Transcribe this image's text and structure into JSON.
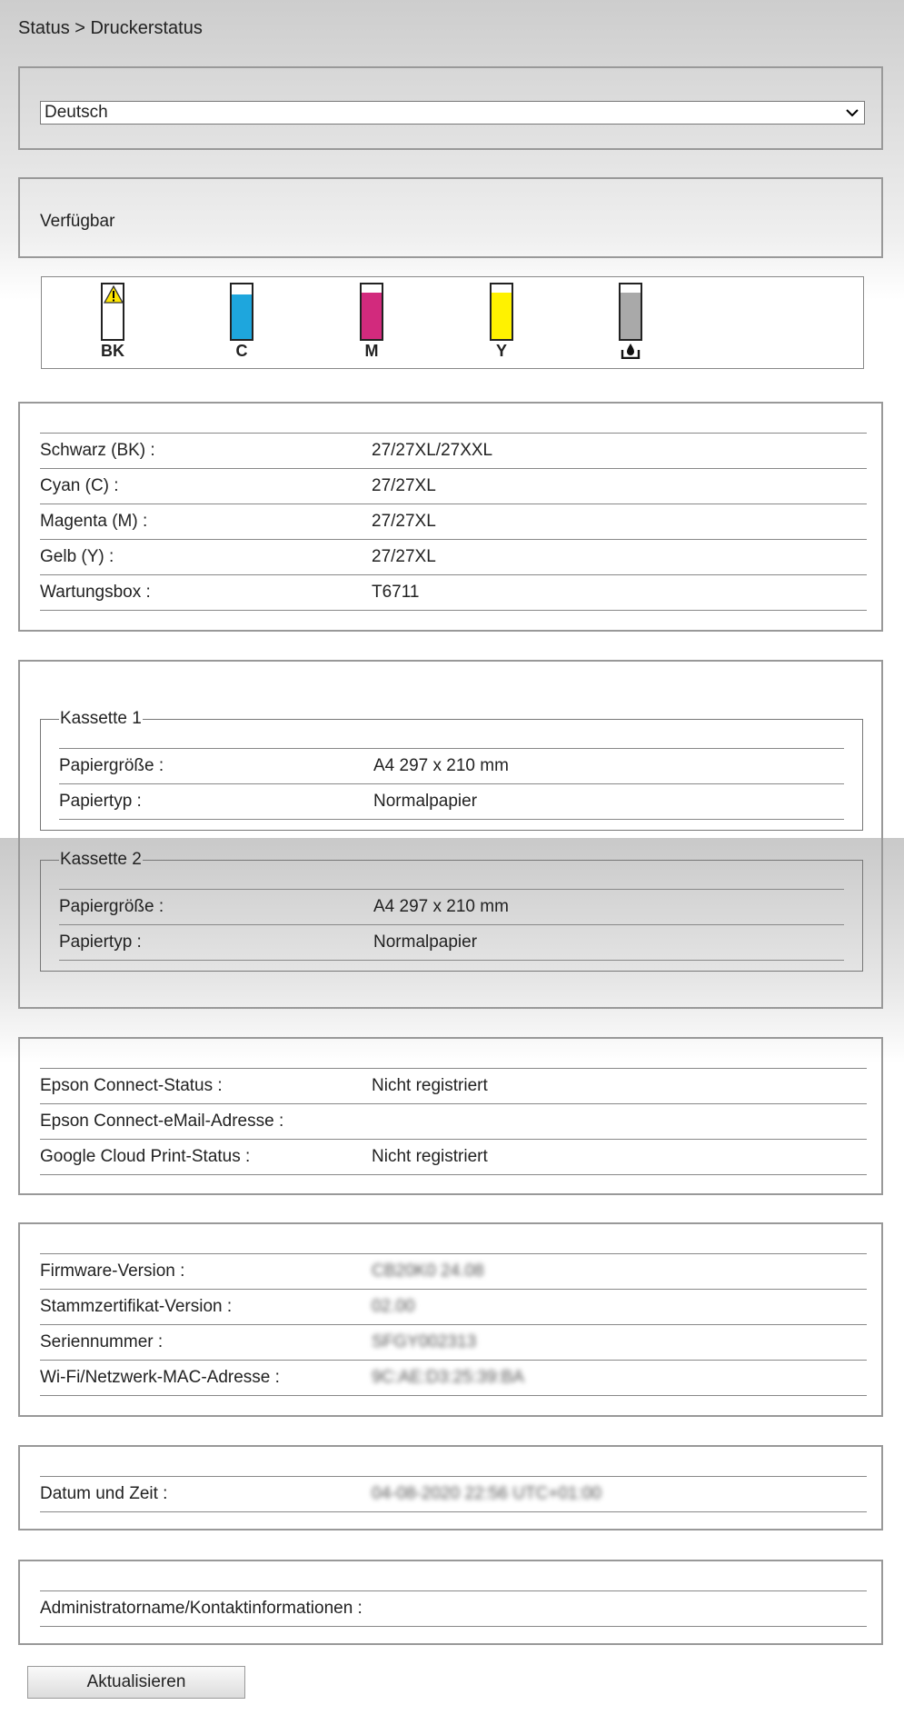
{
  "breadcrumb": "Status > Druckerstatus",
  "language": {
    "selected": "Deutsch"
  },
  "availability": "Verfügbar",
  "ink_levels": [
    {
      "label": "BK",
      "color": "#ffffff",
      "level": 0.0,
      "warning": true
    },
    {
      "label": "C",
      "color": "#1ea6dd",
      "level": 0.82,
      "warning": false
    },
    {
      "label": "M",
      "color": "#d22a7d",
      "level": 0.85,
      "warning": false
    },
    {
      "label": "Y",
      "color": "#fff200",
      "level": 0.85,
      "warning": false
    },
    {
      "label": "",
      "color": "#a9a9a9",
      "level": 0.85,
      "warning": false,
      "icon": "maintenance-box-icon"
    }
  ],
  "cartridges": [
    {
      "key": "Schwarz (BK) :",
      "value": "27/27XL/27XXL"
    },
    {
      "key": "Cyan (C) :",
      "value": "27/27XL"
    },
    {
      "key": "Magenta (M) :",
      "value": "27/27XL"
    },
    {
      "key": "Gelb (Y) :",
      "value": "27/27XL"
    },
    {
      "key": "Wartungsbox :",
      "value": "T6711"
    }
  ],
  "cassettes": [
    {
      "name": "Kassette 1",
      "rows": [
        {
          "key": "Papiergröße :",
          "value": "A4 297 x 210 mm"
        },
        {
          "key": "Papiertyp :",
          "value": "Normalpapier"
        }
      ]
    },
    {
      "name": "Kassette 2",
      "rows": [
        {
          "key": "Papiergröße :",
          "value": "A4 297 x 210 mm"
        },
        {
          "key": "Papiertyp :",
          "value": "Normalpapier"
        }
      ]
    }
  ],
  "connect": [
    {
      "key": "Epson Connect-Status :",
      "value": "Nicht registriert"
    },
    {
      "key": "Epson Connect-eMail-Adresse :",
      "value": ""
    },
    {
      "key": "Google Cloud Print-Status :",
      "value": "Nicht registriert"
    }
  ],
  "device": [
    {
      "key": "Firmware-Version :",
      "value": "CB20K0 24.08"
    },
    {
      "key": "Stammzertifikat-Version :",
      "value": "02.00"
    },
    {
      "key": "Seriennummer :",
      "value": "SFGY002313"
    },
    {
      "key": "Wi-Fi/Netzwerk-MAC-Adresse :",
      "value": "9C:AE:D3:25:39:BA"
    }
  ],
  "datetime": [
    {
      "key": "Datum und Zeit :",
      "value": "04-08-2020 22:56 UTC+01:00"
    }
  ],
  "admin": [
    {
      "key": "Administratorname/Kontaktinformationen :",
      "value": ""
    }
  ],
  "refresh_label": "Aktualisieren"
}
